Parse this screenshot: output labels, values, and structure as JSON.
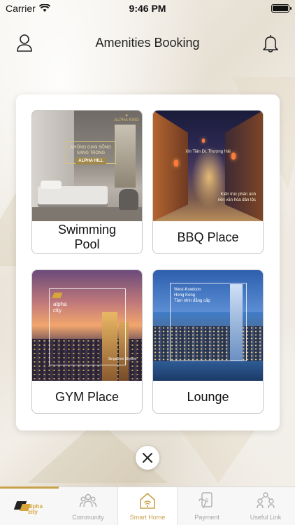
{
  "status_bar": {
    "carrier": "Carrier",
    "time": "9:46 PM"
  },
  "header": {
    "title": "Amenities Booking"
  },
  "amenities": [
    {
      "label": "Swimming Pool",
      "image_banner_line1": "KHÔNG GIAN SỐNG",
      "image_banner_line2": "SANG TRỌNG",
      "image_banner_tag": "ALPHA HILL",
      "image_brand": "ALPHA KING"
    },
    {
      "label": "BBQ Place",
      "image_caption_top": "Xin Tiān Di, Thượng Hải",
      "image_caption_bottom_1": "Kiến trúc phản ánh",
      "image_caption_bottom_2": "nền văn hóa dân tộc"
    },
    {
      "label": "GYM Place",
      "image_logo_line1": "alpha",
      "image_logo_line2": "city",
      "image_caption": "Singapore Skyline"
    },
    {
      "label": "Lounge",
      "image_caption_1": "West-Kowloon",
      "image_caption_2": "Hong Kong",
      "image_caption_3": "Tầm nhìn đẳng cấp"
    }
  ],
  "tabbar": {
    "home_logo_line1": "alpha",
    "home_logo_line2": "city",
    "tabs": [
      {
        "label": "Community",
        "icon": "community-icon"
      },
      {
        "label": "Smart Home",
        "icon": "smart-home-icon"
      },
      {
        "label": "Payment",
        "icon": "payment-icon"
      },
      {
        "label": "Useful Link",
        "icon": "useful-link-icon"
      }
    ],
    "active": "Smart Home"
  },
  "colors": {
    "accent": "#c9a14a",
    "inactive": "#a5a5a5"
  }
}
